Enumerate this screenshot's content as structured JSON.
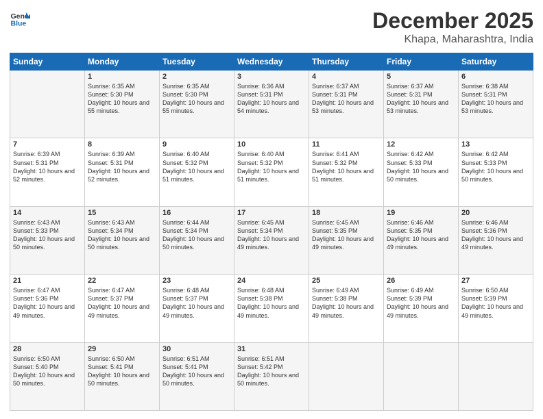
{
  "header": {
    "logo_line1": "General",
    "logo_line2": "Blue",
    "month_title": "December 2025",
    "location": "Khapa, Maharashtra, India"
  },
  "days_of_week": [
    "Sunday",
    "Monday",
    "Tuesday",
    "Wednesday",
    "Thursday",
    "Friday",
    "Saturday"
  ],
  "weeks": [
    [
      {
        "day": "",
        "sunrise": "",
        "sunset": "",
        "daylight": ""
      },
      {
        "day": "1",
        "sunrise": "Sunrise: 6:35 AM",
        "sunset": "Sunset: 5:30 PM",
        "daylight": "Daylight: 10 hours and 55 minutes."
      },
      {
        "day": "2",
        "sunrise": "Sunrise: 6:35 AM",
        "sunset": "Sunset: 5:30 PM",
        "daylight": "Daylight: 10 hours and 55 minutes."
      },
      {
        "day": "3",
        "sunrise": "Sunrise: 6:36 AM",
        "sunset": "Sunset: 5:31 PM",
        "daylight": "Daylight: 10 hours and 54 minutes."
      },
      {
        "day": "4",
        "sunrise": "Sunrise: 6:37 AM",
        "sunset": "Sunset: 5:31 PM",
        "daylight": "Daylight: 10 hours and 53 minutes."
      },
      {
        "day": "5",
        "sunrise": "Sunrise: 6:37 AM",
        "sunset": "Sunset: 5:31 PM",
        "daylight": "Daylight: 10 hours and 53 minutes."
      },
      {
        "day": "6",
        "sunrise": "Sunrise: 6:38 AM",
        "sunset": "Sunset: 5:31 PM",
        "daylight": "Daylight: 10 hours and 53 minutes."
      }
    ],
    [
      {
        "day": "7",
        "sunrise": "Sunrise: 6:39 AM",
        "sunset": "Sunset: 5:31 PM",
        "daylight": "Daylight: 10 hours and 52 minutes."
      },
      {
        "day": "8",
        "sunrise": "Sunrise: 6:39 AM",
        "sunset": "Sunset: 5:31 PM",
        "daylight": "Daylight: 10 hours and 52 minutes."
      },
      {
        "day": "9",
        "sunrise": "Sunrise: 6:40 AM",
        "sunset": "Sunset: 5:32 PM",
        "daylight": "Daylight: 10 hours and 51 minutes."
      },
      {
        "day": "10",
        "sunrise": "Sunrise: 6:40 AM",
        "sunset": "Sunset: 5:32 PM",
        "daylight": "Daylight: 10 hours and 51 minutes."
      },
      {
        "day": "11",
        "sunrise": "Sunrise: 6:41 AM",
        "sunset": "Sunset: 5:32 PM",
        "daylight": "Daylight: 10 hours and 51 minutes."
      },
      {
        "day": "12",
        "sunrise": "Sunrise: 6:42 AM",
        "sunset": "Sunset: 5:33 PM",
        "daylight": "Daylight: 10 hours and 50 minutes."
      },
      {
        "day": "13",
        "sunrise": "Sunrise: 6:42 AM",
        "sunset": "Sunset: 5:33 PM",
        "daylight": "Daylight: 10 hours and 50 minutes."
      }
    ],
    [
      {
        "day": "14",
        "sunrise": "Sunrise: 6:43 AM",
        "sunset": "Sunset: 5:33 PM",
        "daylight": "Daylight: 10 hours and 50 minutes."
      },
      {
        "day": "15",
        "sunrise": "Sunrise: 6:43 AM",
        "sunset": "Sunset: 5:34 PM",
        "daylight": "Daylight: 10 hours and 50 minutes."
      },
      {
        "day": "16",
        "sunrise": "Sunrise: 6:44 AM",
        "sunset": "Sunset: 5:34 PM",
        "daylight": "Daylight: 10 hours and 50 minutes."
      },
      {
        "day": "17",
        "sunrise": "Sunrise: 6:45 AM",
        "sunset": "Sunset: 5:34 PM",
        "daylight": "Daylight: 10 hours and 49 minutes."
      },
      {
        "day": "18",
        "sunrise": "Sunrise: 6:45 AM",
        "sunset": "Sunset: 5:35 PM",
        "daylight": "Daylight: 10 hours and 49 minutes."
      },
      {
        "day": "19",
        "sunrise": "Sunrise: 6:46 AM",
        "sunset": "Sunset: 5:35 PM",
        "daylight": "Daylight: 10 hours and 49 minutes."
      },
      {
        "day": "20",
        "sunrise": "Sunrise: 6:46 AM",
        "sunset": "Sunset: 5:36 PM",
        "daylight": "Daylight: 10 hours and 49 minutes."
      }
    ],
    [
      {
        "day": "21",
        "sunrise": "Sunrise: 6:47 AM",
        "sunset": "Sunset: 5:36 PM",
        "daylight": "Daylight: 10 hours and 49 minutes."
      },
      {
        "day": "22",
        "sunrise": "Sunrise: 6:47 AM",
        "sunset": "Sunset: 5:37 PM",
        "daylight": "Daylight: 10 hours and 49 minutes."
      },
      {
        "day": "23",
        "sunrise": "Sunrise: 6:48 AM",
        "sunset": "Sunset: 5:37 PM",
        "daylight": "Daylight: 10 hours and 49 minutes."
      },
      {
        "day": "24",
        "sunrise": "Sunrise: 6:48 AM",
        "sunset": "Sunset: 5:38 PM",
        "daylight": "Daylight: 10 hours and 49 minutes."
      },
      {
        "day": "25",
        "sunrise": "Sunrise: 6:49 AM",
        "sunset": "Sunset: 5:38 PM",
        "daylight": "Daylight: 10 hours and 49 minutes."
      },
      {
        "day": "26",
        "sunrise": "Sunrise: 6:49 AM",
        "sunset": "Sunset: 5:39 PM",
        "daylight": "Daylight: 10 hours and 49 minutes."
      },
      {
        "day": "27",
        "sunrise": "Sunrise: 6:50 AM",
        "sunset": "Sunset: 5:39 PM",
        "daylight": "Daylight: 10 hours and 49 minutes."
      }
    ],
    [
      {
        "day": "28",
        "sunrise": "Sunrise: 6:50 AM",
        "sunset": "Sunset: 5:40 PM",
        "daylight": "Daylight: 10 hours and 50 minutes."
      },
      {
        "day": "29",
        "sunrise": "Sunrise: 6:50 AM",
        "sunset": "Sunset: 5:41 PM",
        "daylight": "Daylight: 10 hours and 50 minutes."
      },
      {
        "day": "30",
        "sunrise": "Sunrise: 6:51 AM",
        "sunset": "Sunset: 5:41 PM",
        "daylight": "Daylight: 10 hours and 50 minutes."
      },
      {
        "day": "31",
        "sunrise": "Sunrise: 6:51 AM",
        "sunset": "Sunset: 5:42 PM",
        "daylight": "Daylight: 10 hours and 50 minutes."
      },
      {
        "day": "",
        "sunrise": "",
        "sunset": "",
        "daylight": ""
      },
      {
        "day": "",
        "sunrise": "",
        "sunset": "",
        "daylight": ""
      },
      {
        "day": "",
        "sunrise": "",
        "sunset": "",
        "daylight": ""
      }
    ]
  ]
}
